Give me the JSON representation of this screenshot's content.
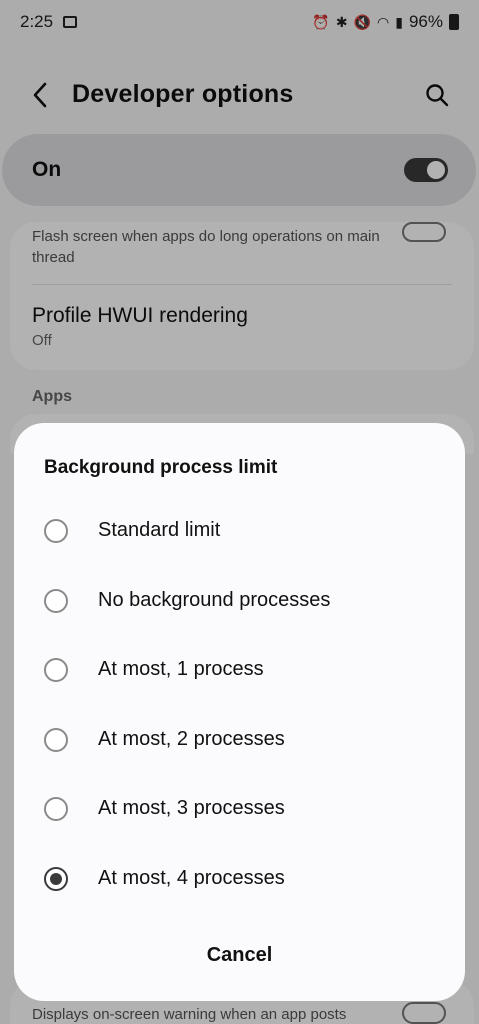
{
  "status_bar": {
    "time": "2:25",
    "icons": [
      "image-icon",
      "alarm-icon",
      "bluetooth-icon",
      "mute-icon",
      "wifi-icon",
      "volte-icon",
      "signal-icon"
    ],
    "battery": "96%"
  },
  "header": {
    "title": "Developer options"
  },
  "master_switch": {
    "label": "On",
    "state": "on"
  },
  "settings": {
    "flash_screen_text": "Flash screen when apps do long operations on main thread",
    "profile_title": "Profile HWUI rendering",
    "profile_value": "Off",
    "apps_header": "Apps",
    "bottom_text": "Displays on-screen warning when an app posts"
  },
  "dialog": {
    "title": "Background process limit",
    "options": [
      {
        "label": "Standard limit",
        "selected": false
      },
      {
        "label": "No background processes",
        "selected": false
      },
      {
        "label": "At most, 1 process",
        "selected": false
      },
      {
        "label": "At most, 2 processes",
        "selected": false
      },
      {
        "label": "At most, 3 processes",
        "selected": false
      },
      {
        "label": "At most, 4 processes",
        "selected": true
      }
    ],
    "cancel_label": "Cancel"
  }
}
